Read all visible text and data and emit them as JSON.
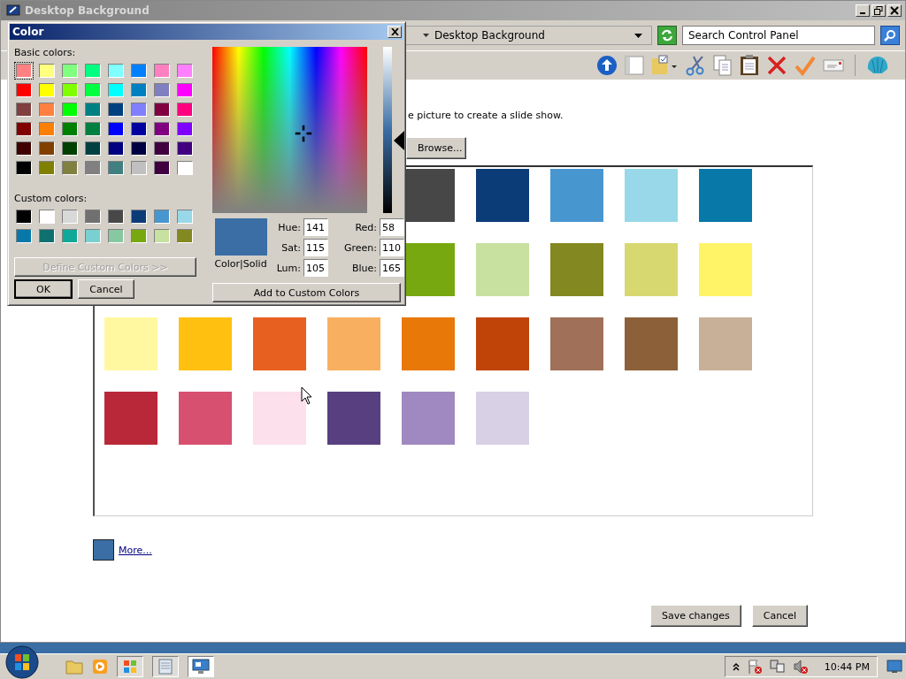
{
  "window": {
    "title": "Desktop Background"
  },
  "address": {
    "crumb": "Desktop Background",
    "search_placeholder": "Search Control Panel"
  },
  "content": {
    "instruction": "e picture to create a slide show.",
    "browse_button": "Browse...",
    "swatch_rows": [
      {
        "covered": true,
        "swatches": [
          {
            "color": "#474747"
          },
          {
            "color": "#0c3c78"
          },
          {
            "color": "#4896d0"
          },
          {
            "color": "#98d8e8"
          },
          {
            "color": "#0878a8"
          }
        ]
      },
      {
        "covered": true,
        "swatches": [
          {
            "color": "#78a810"
          },
          {
            "color": "#c8e0a0"
          },
          {
            "color": "#848820"
          },
          {
            "color": "#d8d870"
          },
          {
            "color": "#fff468"
          }
        ]
      },
      {
        "swatches": [
          {
            "color": "#fff8a0"
          },
          {
            "color": "#ffc010"
          },
          {
            "color": "#e86020"
          },
          {
            "color": "#f8b060"
          },
          {
            "color": "#e87808"
          },
          {
            "color": "#c04408"
          },
          {
            "color": "#a07058"
          },
          {
            "color": "#8c6038"
          },
          {
            "color": "#c8b098"
          }
        ]
      },
      {
        "swatches": [
          {
            "color": "#b82838"
          },
          {
            "color": "#d85070"
          },
          {
            "color": "#fce0ec"
          },
          {
            "color": "#584080"
          },
          {
            "color": "#a088c0"
          },
          {
            "color": "#d8d0e4"
          }
        ]
      }
    ],
    "current_swatch": {
      "color": "#3a6ea5"
    },
    "more_link": "More...",
    "save_button": "Save changes",
    "cancel_button": "Cancel"
  },
  "dialog": {
    "title": "Color",
    "basic_label": "Basic colors:",
    "basic_colors": [
      {
        "color": "#ff8080",
        "selected": true
      },
      {
        "color": "#ffff80",
        "selected": false
      },
      {
        "color": "#80ff80",
        "selected": false
      },
      {
        "color": "#00ff80",
        "selected": false
      },
      {
        "color": "#80ffff",
        "selected": false
      },
      {
        "color": "#0080ff",
        "selected": false
      },
      {
        "color": "#ff80c0",
        "selected": false
      },
      {
        "color": "#ff80ff",
        "selected": false
      },
      {
        "color": "#ff0000",
        "selected": false
      },
      {
        "color": "#ffff00",
        "selected": false
      },
      {
        "color": "#80ff00",
        "selected": false
      },
      {
        "color": "#00ff40",
        "selected": false
      },
      {
        "color": "#00ffff",
        "selected": false
      },
      {
        "color": "#0080c0",
        "selected": false
      },
      {
        "color": "#8080c0",
        "selected": false
      },
      {
        "color": "#ff00ff",
        "selected": false
      },
      {
        "color": "#804040",
        "selected": false
      },
      {
        "color": "#ff8040",
        "selected": false
      },
      {
        "color": "#00ff00",
        "selected": false
      },
      {
        "color": "#008080",
        "selected": false
      },
      {
        "color": "#004080",
        "selected": false
      },
      {
        "color": "#8080ff",
        "selected": false
      },
      {
        "color": "#800040",
        "selected": false
      },
      {
        "color": "#ff0080",
        "selected": false
      },
      {
        "color": "#800000",
        "selected": false
      },
      {
        "color": "#ff8000",
        "selected": false
      },
      {
        "color": "#008000",
        "selected": false
      },
      {
        "color": "#008040",
        "selected": false
      },
      {
        "color": "#0000ff",
        "selected": false
      },
      {
        "color": "#0000a0",
        "selected": false
      },
      {
        "color": "#800080",
        "selected": false
      },
      {
        "color": "#8000ff",
        "selected": false
      },
      {
        "color": "#400000",
        "selected": false
      },
      {
        "color": "#804000",
        "selected": false
      },
      {
        "color": "#004000",
        "selected": false
      },
      {
        "color": "#004040",
        "selected": false
      },
      {
        "color": "#000080",
        "selected": false
      },
      {
        "color": "#000040",
        "selected": false
      },
      {
        "color": "#400040",
        "selected": false
      },
      {
        "color": "#400080",
        "selected": false
      },
      {
        "color": "#000000",
        "selected": false
      },
      {
        "color": "#808000",
        "selected": false
      },
      {
        "color": "#808040",
        "selected": false
      },
      {
        "color": "#808080",
        "selected": false
      },
      {
        "color": "#408080",
        "selected": false
      },
      {
        "color": "#c0c0c0",
        "selected": false
      },
      {
        "color": "#400040",
        "selected": false
      },
      {
        "color": "#ffffff",
        "selected": false
      }
    ],
    "custom_label": "Custom colors:",
    "custom_colors": [
      {
        "color": "#000000"
      },
      {
        "color": "#ffffff"
      },
      {
        "color": "#d8d8d8"
      },
      {
        "color": "#707070"
      },
      {
        "color": "#484848"
      },
      {
        "color": "#0c3c78"
      },
      {
        "color": "#4896d0"
      },
      {
        "color": "#98d8e8"
      },
      {
        "color": "#0878a8"
      },
      {
        "color": "#107070"
      },
      {
        "color": "#10a898"
      },
      {
        "color": "#78d0d0"
      },
      {
        "color": "#88c8a0"
      },
      {
        "color": "#78a810"
      },
      {
        "color": "#c8e0a0"
      },
      {
        "color": "#848820"
      }
    ],
    "define_button": {
      "label": "Define Custom Colors >>",
      "disabled": true
    },
    "ok_button": "OK",
    "cancel_button": "Cancel",
    "preview_label": "Color|Solid",
    "fields": [
      {
        "label": "Hue:",
        "value": "141"
      },
      {
        "label": "Red:",
        "value": "58"
      },
      {
        "label": "Sat:",
        "value": "115"
      },
      {
        "label": "Green:",
        "value": "110"
      },
      {
        "label": "Lum:",
        "value": "105"
      },
      {
        "label": "Blue:",
        "value": "165"
      }
    ],
    "add_button": "Add to Custom Colors"
  },
  "taskbar": {
    "clock": "10:44 PM"
  }
}
